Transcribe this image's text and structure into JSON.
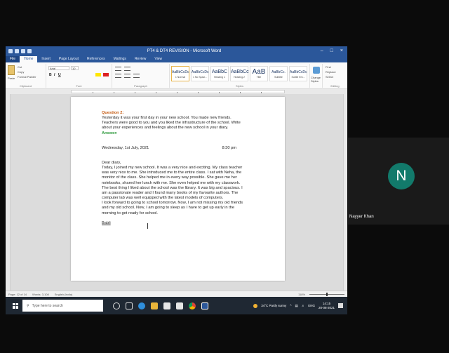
{
  "window": {
    "title": "PT4 & DT4 REVISION - Microsoft Word",
    "controls": [
      "–",
      "□",
      "×"
    ]
  },
  "tabs": [
    "File",
    "Home",
    "Insert",
    "Page Layout",
    "References",
    "Mailings",
    "Review",
    "View"
  ],
  "ribbon": {
    "clipboard": {
      "cut": "Cut",
      "copy": "Copy",
      "format_painter": "Format Painter",
      "label": "Clipboard",
      "paste": "Paste"
    },
    "font": {
      "name": "Arial",
      "size": "10",
      "label": "Font",
      "bold": "B",
      "italic": "I",
      "underline": "U"
    },
    "paragraph_label": "Paragraph",
    "styles": [
      {
        "sample": "AaBbCcDc",
        "name": "1 Normal"
      },
      {
        "sample": "AaBbCcDc",
        "name": "1 No Spaci..."
      },
      {
        "sample": "AaBbC",
        "name": "Heading 1"
      },
      {
        "sample": "AaBbCc",
        "name": "Heading 2"
      },
      {
        "sample": "AaB",
        "name": "Title"
      },
      {
        "sample": "AaBbCc.",
        "name": "Subtitle"
      },
      {
        "sample": "AaBbCcDc",
        "name": "Subtle Em..."
      }
    ],
    "styles_label": "Styles",
    "change_styles": "Change Styles",
    "editing": {
      "find": "Find",
      "replace": "Replace",
      "select": "Select",
      "label": "Editing"
    }
  },
  "document": {
    "question_label": "Question 2:",
    "question_lines": [
      "Yesterday it was your first day in your new school. You made new friends.",
      "Teachers were good to you and you liked the infrastructure of the school. Write",
      "about your experiences and feelings about the new school in your diary."
    ],
    "answer_label": "Answer:",
    "date": "Wednesday, 1st July, 2021",
    "time": "8:30 pm",
    "salutation": "Dear diary,",
    "body_lines": [
      "Today, I joined my new school. It was a very nice and exciting. My class teacher",
      "was very nice to me. She introduced me to the entire class. I sat with Neha, the",
      "monitor of the class. She helped me in every way possible. She gave me her",
      "notebooks, shared her lunch with me. She even helped me with my classwork.",
      "The best thing I liked about the school was the library. It was big and spacious. I",
      "am a passionate reader and I found many books of my favourite authors. The",
      "computer lab was well equipped with the latest models of computers.",
      "I look forward to going to school tomorrow. Now, I am not missing my old friends",
      "and my old school. Now, I am going to sleep as I have to get up early in the",
      "morning to get ready for school."
    ],
    "signature": "Babli"
  },
  "status": {
    "page": "Page: 12 of 14",
    "words": "Words: 3,108",
    "language": "English (India)",
    "zoom": "118%"
  },
  "taskbar": {
    "search_placeholder": "Type here to search",
    "weather": "34°C Partly sunny",
    "lang": "ENG",
    "time": "14:15",
    "date": "20-08-2021"
  },
  "participant": {
    "initial": "N",
    "name": "Nayyer Khan",
    "avatar_color": "#127a6b"
  },
  "colors": {
    "word_blue": "#2b579a",
    "question_orange": "#c55a11",
    "answer_green": "#2e9a3d"
  }
}
